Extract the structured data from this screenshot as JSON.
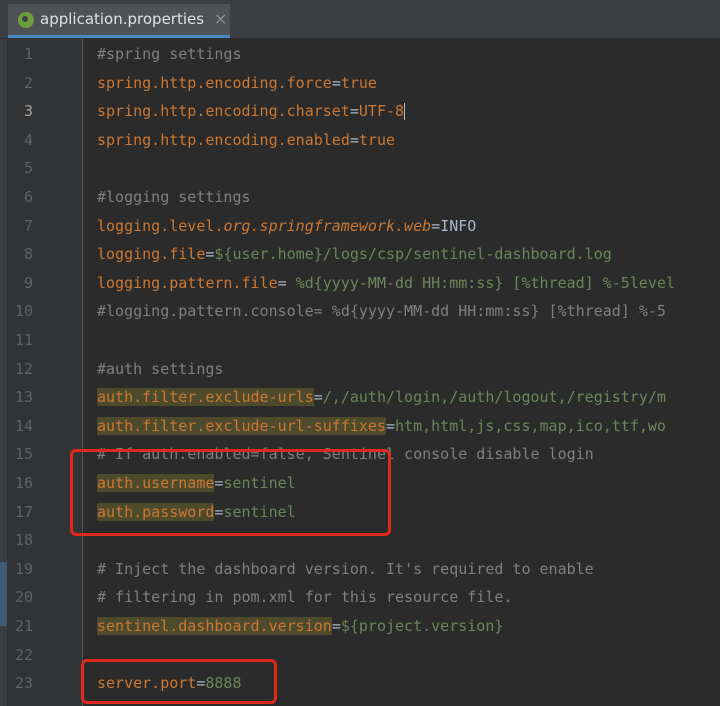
{
  "tab": {
    "title": "application.properties",
    "close": "×",
    "icon": "spring-leaf-icon"
  },
  "editor": {
    "current_line": 3,
    "lines": [
      {
        "n": "1",
        "segs": [
          {
            "t": "#spring settings",
            "c": "cmt"
          }
        ]
      },
      {
        "n": "2",
        "segs": [
          {
            "t": "spring.http.encoding.force",
            "c": "key"
          },
          {
            "t": "=",
            "c": "eq"
          },
          {
            "t": "true",
            "c": "key"
          }
        ]
      },
      {
        "n": "3",
        "segs": [
          {
            "t": "spring.http.encoding.charset",
            "c": "key"
          },
          {
            "t": "=",
            "c": "eq"
          },
          {
            "t": "UTF-8",
            "c": "key"
          }
        ],
        "caret": true
      },
      {
        "n": "4",
        "segs": [
          {
            "t": "spring.http.encoding.enabled",
            "c": "key"
          },
          {
            "t": "=",
            "c": "eq"
          },
          {
            "t": "true",
            "c": "key"
          }
        ]
      },
      {
        "n": "5",
        "segs": []
      },
      {
        "n": "6",
        "segs": [
          {
            "t": "#logging settings",
            "c": "cmt"
          }
        ]
      },
      {
        "n": "7",
        "segs": [
          {
            "t": "logging.level.",
            "c": "key"
          },
          {
            "t": "org.springframework.web",
            "c": "key italic"
          },
          {
            "t": "=",
            "c": "eq"
          },
          {
            "t": "INFO",
            "c": "eq"
          }
        ]
      },
      {
        "n": "8",
        "segs": [
          {
            "t": "logging.file",
            "c": "key"
          },
          {
            "t": "=",
            "c": "eq"
          },
          {
            "t": "${user.home}/logs/csp/sentinel-dashboard.log",
            "c": "val"
          }
        ]
      },
      {
        "n": "9",
        "segs": [
          {
            "t": "logging.pattern.file",
            "c": "key"
          },
          {
            "t": "= ",
            "c": "eq"
          },
          {
            "t": "%d{yyyy-MM-dd HH:mm:ss} [%thread] %-5level",
            "c": "val"
          }
        ]
      },
      {
        "n": "10",
        "segs": [
          {
            "t": "#logging.pattern.console= %d{yyyy-MM-dd HH:mm:ss} [%thread] %-5",
            "c": "cmt"
          }
        ]
      },
      {
        "n": "11",
        "segs": []
      },
      {
        "n": "12",
        "segs": [
          {
            "t": "#auth settings",
            "c": "cmt"
          }
        ]
      },
      {
        "n": "13",
        "segs": [
          {
            "t": "auth.filter.exclude-urls",
            "c": "key hl"
          },
          {
            "t": "=",
            "c": "eq"
          },
          {
            "t": "/,/auth/login,/auth/logout,/registry/m",
            "c": "val"
          }
        ]
      },
      {
        "n": "14",
        "segs": [
          {
            "t": "auth.filter.exclude-url-suffixes",
            "c": "key hl"
          },
          {
            "t": "=",
            "c": "eq"
          },
          {
            "t": "htm,html,js,css,map,ico,ttf,wo",
            "c": "val"
          }
        ]
      },
      {
        "n": "15",
        "segs": [
          {
            "t": "# If auth.enabled=false, Sentinel console disable login",
            "c": "cmt"
          }
        ]
      },
      {
        "n": "16",
        "segs": [
          {
            "t": "auth.username",
            "c": "key hl"
          },
          {
            "t": "=",
            "c": "eq"
          },
          {
            "t": "sentinel",
            "c": "val"
          }
        ]
      },
      {
        "n": "17",
        "segs": [
          {
            "t": "auth.password",
            "c": "key hl"
          },
          {
            "t": "=",
            "c": "eq"
          },
          {
            "t": "sentinel",
            "c": "val"
          }
        ]
      },
      {
        "n": "18",
        "segs": []
      },
      {
        "n": "19",
        "segs": [
          {
            "t": "# Inject the dashboard version. It's required to enable",
            "c": "cmt"
          }
        ]
      },
      {
        "n": "20",
        "segs": [
          {
            "t": "# filtering in pom.xml for this resource file.",
            "c": "cmt"
          }
        ]
      },
      {
        "n": "21",
        "segs": [
          {
            "t": "sentinel.dashboard.version",
            "c": "key hl"
          },
          {
            "t": "=",
            "c": "eq"
          },
          {
            "t": "${project.version}",
            "c": "val"
          }
        ]
      },
      {
        "n": "22",
        "segs": []
      },
      {
        "n": "23",
        "segs": [
          {
            "t": "server.port",
            "c": "key"
          },
          {
            "t": "=",
            "c": "eq"
          },
          {
            "t": "8888",
            "c": "val"
          }
        ]
      }
    ]
  },
  "colors": {
    "annotation": "#e0291e",
    "background": "#2b2b2b",
    "key": "#cc7832",
    "value": "#6a8759",
    "comment": "#808080"
  }
}
